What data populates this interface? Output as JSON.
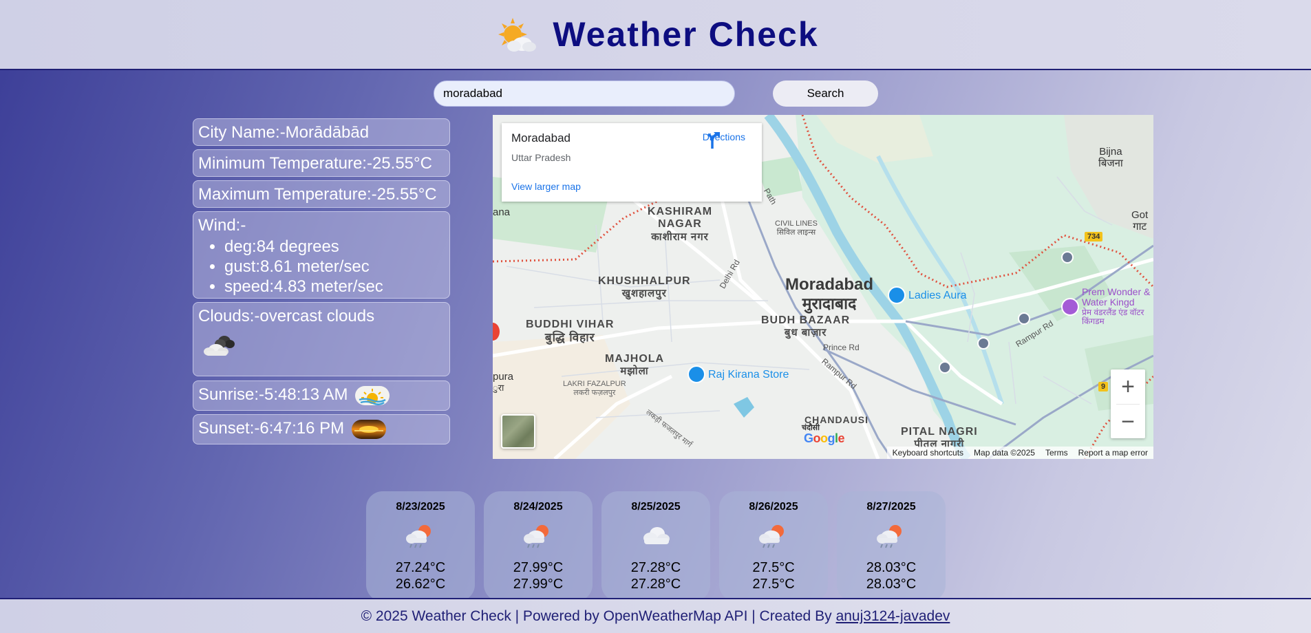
{
  "header": {
    "title": "Weather Check",
    "icon": "sun-behind-cloud-icon"
  },
  "search": {
    "value": "moradabad",
    "button_label": "Search"
  },
  "info": {
    "city": "City Name:-Morādābād",
    "min_temp": "Minimum Temperature:-25.55°C",
    "max_temp": "Maximum Temperature:-25.55°C",
    "wind_label": "Wind:-",
    "wind_items": [
      "deg:84 degrees",
      "gust:8.61 meter/sec",
      "speed:4.83 meter/sec"
    ],
    "clouds": "Clouds:-overcast clouds",
    "sunrise": "Sunrise:-5:48:13 AM",
    "sunset": "Sunset:-6:47:16 PM"
  },
  "map": {
    "card_place": "Moradabad",
    "card_region": "Uttar Pradesh",
    "card_directions": "Directions",
    "card_larger": "View larger map",
    "labels": {
      "kashiram_en": "KASHIRAM NAGAR",
      "kashiram_hi": "काशीराम नगर",
      "khushhalpur_en": "KHUSHHALPUR",
      "khushhalpur_hi": "खुशहालपुर",
      "buddhi_en": "BUDDHI VIHAR",
      "buddhi_hi": "बुद्धि विहार",
      "majhola_en": "MAJHOLA",
      "majhola_hi": "मझोला",
      "lakri_en": "LAKRI FAZALPUR",
      "lakri_hi": "लकरी फज़लपुर",
      "civil_en": "CIVIL LINES",
      "civil_hi": "सिविल लाइन्स",
      "city_en": "Moradabad",
      "city_hi": "मुरादाबाद",
      "budh_en": "BUDH BAZAAR",
      "budh_hi": "बुध बाज़ार",
      "chandausi_en": "CHANDAUSI",
      "chandausi_hi": "चंदौसी",
      "pital_en": "PITAL NAGRI",
      "pital_hi": "पीतल नागरी",
      "bijna_en": "Bijna",
      "bijna_hi": "बिजना",
      "got_en": "Got",
      "got_hi": "गाट",
      "prem_en": "Prem Wonder & Water Kingd",
      "prem_hi": "प्रेम वंडरलैंड एंड वॉटर किंगडम",
      "ladies": "Ladies Aura",
      "raj": "Raj Kirana Store",
      "delhi_rd": "Delhi Rd",
      "prince_rd": "Prince Rd",
      "rampur_rd": "Rampur Rd",
      "rampur_rd2": "Rampur Rd",
      "path": "Path",
      "lakdi_rd": "लकड़ी फजलपुर मार्ग",
      "ana": "ana",
      "pura": "pura",
      "ura": "ुरा",
      "road_734": "734",
      "road_9": "9"
    },
    "footer": [
      "Keyboard shortcuts",
      "Map data ©2025",
      "Terms",
      "Report a map error"
    ],
    "google": "Google"
  },
  "forecast": [
    {
      "date": "8/23/2025",
      "icon": "rain-cloud-icon",
      "t1": "27.24°C",
      "t2": "26.62°C"
    },
    {
      "date": "8/24/2025",
      "icon": "rain-cloud-icon",
      "t1": "27.99°C",
      "t2": "27.99°C"
    },
    {
      "date": "8/25/2025",
      "icon": "cloud-icon",
      "t1": "27.28°C",
      "t2": "27.28°C"
    },
    {
      "date": "8/26/2025",
      "icon": "rain-cloud-icon",
      "t1": "27.5°C",
      "t2": "27.5°C"
    },
    {
      "date": "8/27/2025",
      "icon": "rain-cloud-icon",
      "t1": "28.03°C",
      "t2": "28.03°C"
    }
  ],
  "footer": {
    "text": "© 2025 Weather Check | Powered by OpenWeatherMap API | Created By",
    "link": "anuj3124-javadev"
  }
}
